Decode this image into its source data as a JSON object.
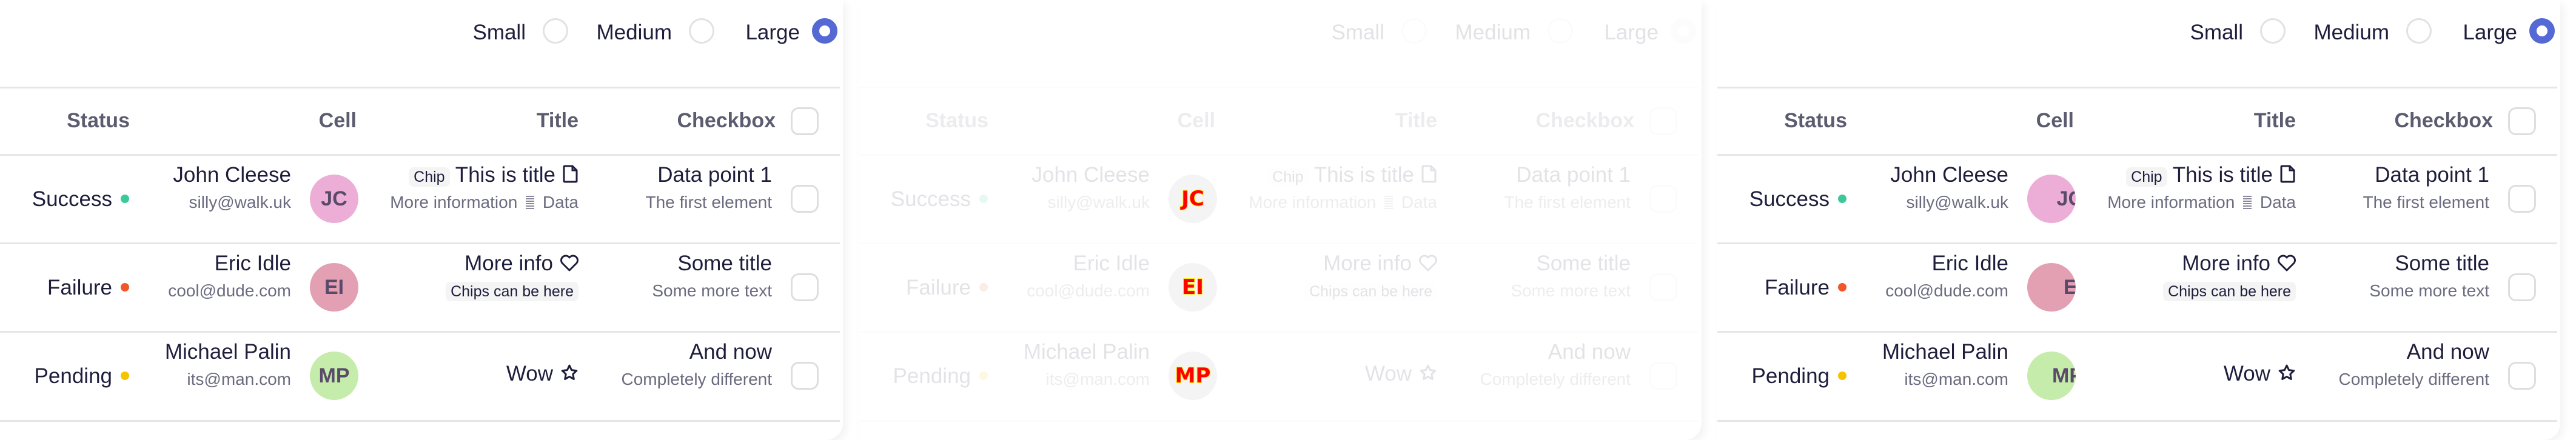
{
  "size_selector": {
    "options": [
      {
        "label": "Small",
        "selected": false
      },
      {
        "label": "Medium",
        "selected": false
      },
      {
        "label": "Large",
        "selected": true
      }
    ],
    "accent_color": "#5469d4"
  },
  "table": {
    "headers": {
      "status": "Status",
      "cell": "Cell",
      "title": "Title",
      "checkbox": "Checkbox"
    },
    "rows": [
      {
        "status": "Success",
        "status_color": "#3cc99a",
        "name": "John Cleese",
        "email": "silly@walk.uk",
        "initials": "JC",
        "avatar_color": "#ecaed6",
        "chip": "Chip",
        "title": "This is title",
        "title_icon": "document-icon",
        "subtitle_left": "More information",
        "subtitle_icon": "bars-icon",
        "subtitle_right": "Data",
        "data_title": "Data point 1",
        "data_sub": "The first element",
        "checked": false
      },
      {
        "status": "Failure",
        "status_color": "#f0582a",
        "name": "Eric Idle",
        "email": "cool@dude.com",
        "initials": "EI",
        "avatar_color": "#e2a0b2",
        "title": "More info",
        "title_icon": "heart-icon",
        "chip_below": "Chips can be here",
        "data_title": "Some title",
        "data_sub": "Some more text",
        "checked": false
      },
      {
        "status": "Pending",
        "status_color": "#f5c400",
        "name": "Michael Palin",
        "email": "its@man.com",
        "initials": "MP",
        "avatar_color": "#c5ecaa",
        "title": "Wow",
        "title_icon": "star-icon",
        "data_title": "And now",
        "data_sub": "Completely different",
        "checked": false
      }
    ]
  }
}
